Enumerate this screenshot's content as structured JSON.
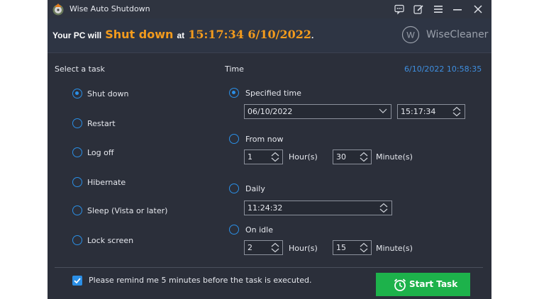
{
  "titlebar": {
    "title": "Wise Auto Shutdown",
    "icons": [
      "feedback-icon",
      "edit-icon",
      "menu-icon",
      "minimize-icon",
      "close-icon"
    ]
  },
  "header": {
    "prefix": "Your PC will",
    "action": "Shut down",
    "at": "at",
    "scheduled": "15:17:34 6/10/2022",
    "period": ".",
    "brand_letter": "W",
    "brand": "WiseCleaner"
  },
  "tasks": {
    "label": "Select a task",
    "selected": "Shut down",
    "items": [
      "Shut down",
      "Restart",
      "Log off",
      "Hibernate",
      "Sleep (Vista or later)",
      "Lock screen"
    ]
  },
  "time": {
    "label": "Time",
    "current": "6/10/2022 10:58:35",
    "selected": "Specified time",
    "specified": {
      "label": "Specified time",
      "date": "06/10/2022",
      "clock": "15:17:34"
    },
    "from_now": {
      "label": "From now",
      "hours": "1",
      "hours_unit": "Hour(s)",
      "minutes": "30",
      "minutes_unit": "Minute(s)"
    },
    "daily": {
      "label": "Daily",
      "clock": "11:24:32"
    },
    "on_idle": {
      "label": "On idle",
      "hours": "2",
      "hours_unit": "Hour(s)",
      "minutes": "15",
      "minutes_unit": "Minute(s)"
    }
  },
  "footer": {
    "remind_checked": true,
    "remind_text": "Please remind me 5 minutes before the task is executed.",
    "start_label": "Start Task"
  },
  "colors": {
    "accent": "#2b8fe6",
    "orange": "#f39b1d",
    "green": "#1db24b",
    "bg": "#2b2f3a"
  }
}
